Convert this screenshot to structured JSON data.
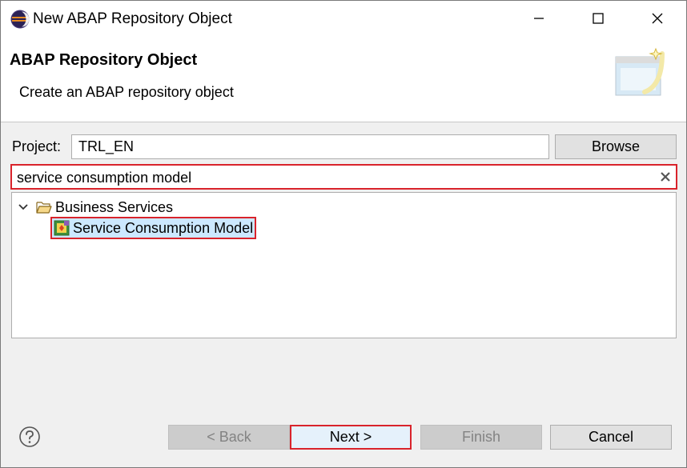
{
  "window": {
    "title": "New ABAP Repository Object",
    "app_icon": "eclipse-icon",
    "controls": [
      "minimize-icon",
      "maximize-icon",
      "close-icon"
    ]
  },
  "banner": {
    "title": "ABAP Repository Object",
    "subtitle": "Create an ABAP repository object",
    "graphic": "wizard-window-icon"
  },
  "project": {
    "label": "Project:",
    "value": "TRL_EN",
    "browse_label": "Browse"
  },
  "search": {
    "value": "service consumption model",
    "clear_icon": "clear-icon"
  },
  "tree": {
    "nodes": [
      {
        "label": "Business Services",
        "icon": "folder-open-icon",
        "expanded": true
      },
      {
        "label": "Service Consumption Model",
        "icon": "service-consumption-model-icon",
        "selected": true
      }
    ]
  },
  "footer": {
    "help_icon": "help-icon",
    "back_label": "< Back",
    "next_label": "Next >",
    "finish_label": "Finish",
    "cancel_label": "Cancel"
  },
  "colors": {
    "highlight_border": "#d9232b",
    "selection_bg": "#cce8ff",
    "dialog_bg": "#f0f0f0"
  }
}
